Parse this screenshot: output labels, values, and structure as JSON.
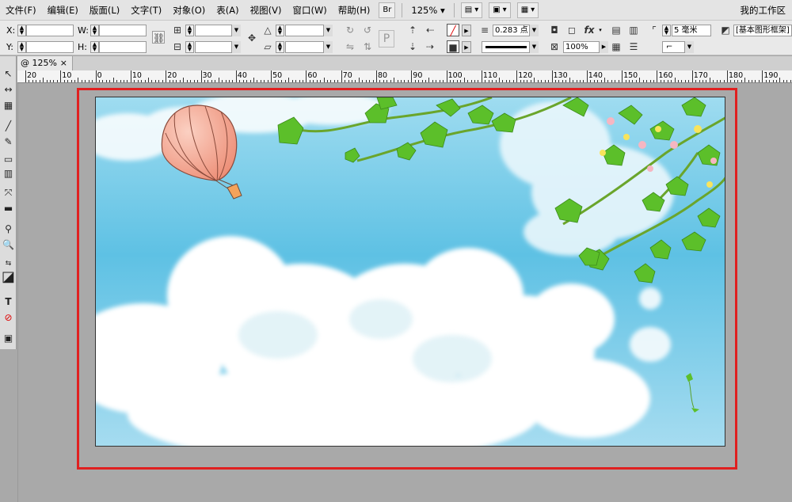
{
  "menu": {
    "items": [
      "文件(F)",
      "编辑(E)",
      "版面(L)",
      "文字(T)",
      "对象(O)",
      "表(A)",
      "视图(V)",
      "窗口(W)",
      "帮助(H)"
    ],
    "bridge_button": "Br",
    "zoom": "125%",
    "workspace": "我的工作区"
  },
  "control": {
    "x_label": "X:",
    "y_label": "Y:",
    "w_label": "W:",
    "h_label": "H:",
    "stroke_weight": "0.283 点",
    "opacity": "100%",
    "corner_size": "5 毫米",
    "frame_style": "[基本图形框架]",
    "proxy_letter": "P"
  },
  "document": {
    "tab_label": "@ 125%",
    "close": "×"
  },
  "ruler": {
    "labels": [
      "20",
      "10",
      "0",
      "10",
      "20",
      "30",
      "40",
      "50",
      "60",
      "70",
      "80",
      "90",
      "100",
      "110",
      "120",
      "130",
      "140",
      "150",
      "160",
      "170",
      "180",
      "190"
    ]
  },
  "colors": {
    "selection_highlight": "#e02020",
    "sky": "#6cc7e6",
    "leaf": "#5cbf2a",
    "balloon": "#f29a84"
  }
}
